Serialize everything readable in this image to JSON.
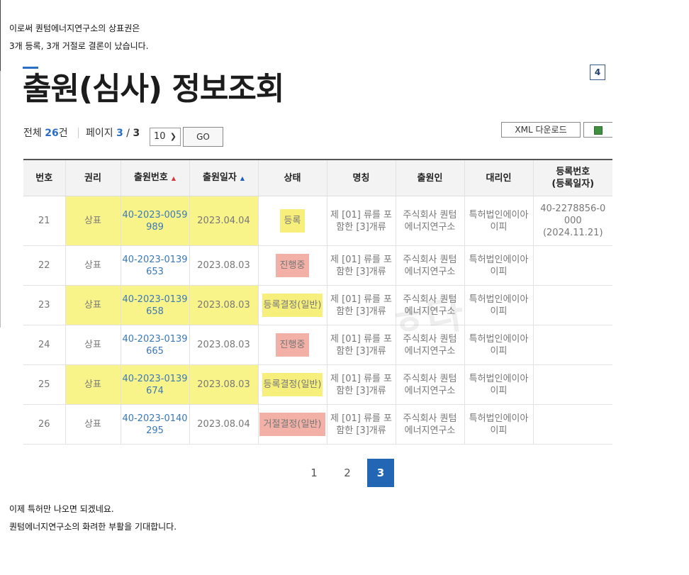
{
  "intro": {
    "line1": "이로써 퀀텀에너지연구소의 상표권은",
    "line2": "3개 등록, 3개 거절로 결론이 났습니다."
  },
  "screenshot": {
    "title": "출원(심사) 정보조회",
    "page_badge": "4",
    "summary": {
      "total_label": "전체",
      "total_count": "26",
      "total_unit": "건",
      "page_label": "페이지",
      "page_current": "3",
      "page_sep": "/",
      "page_total": "3"
    },
    "per_page_value": "10",
    "go_label": "GO",
    "xml_download_label": "XML 다운로드",
    "watermark": "ㅎ다",
    "columns": [
      "번호",
      "권리",
      "출원번호",
      "출원일자",
      "상태",
      "명칭",
      "출원인",
      "대리인",
      "등록번호\n(등록일자)"
    ],
    "rows": [
      {
        "no": "21",
        "right": "상표",
        "app_no": "40-2023-0059\n989",
        "date": "2023.04.04",
        "status": "등록",
        "name": "제 [01] 류를 포\n함한 [3]개류",
        "applicant": "주식회사 퀀텀\n에너지연구소",
        "agent": "특허법인에이아\n이피",
        "reg": "40-2278856-0\n000\n(2024.11.21)"
      },
      {
        "no": "22",
        "right": "상표",
        "app_no": "40-2023-0139\n653",
        "date": "2023.08.03",
        "status": "진행중",
        "name": "제 [01] 류를 포\n함한 [3]개류",
        "applicant": "주식회사 퀀텀\n에너지연구소",
        "agent": "특허법인에이아\n이피",
        "reg": ""
      },
      {
        "no": "23",
        "right": "상표",
        "app_no": "40-2023-0139\n658",
        "date": "2023.08.03",
        "status": "등록결정(일반)",
        "name": "제 [01] 류를 포\n함한 [3]개류",
        "applicant": "주식회사 퀀텀\n에너지연구소",
        "agent": "특허법인에이아\n이피",
        "reg": ""
      },
      {
        "no": "24",
        "right": "상표",
        "app_no": "40-2023-0139\n665",
        "date": "2023.08.03",
        "status": "진행중",
        "name": "제 [01] 류를 포\n함한 [3]개류",
        "applicant": "주식회사 퀀텀\n에너지연구소",
        "agent": "특허법인에이아\n이피",
        "reg": ""
      },
      {
        "no": "25",
        "right": "상표",
        "app_no": "40-2023-0139\n674",
        "date": "2023.08.03",
        "status": "등록결정(일반)",
        "name": "제 [01] 류를 포\n함한 [3]개류",
        "applicant": "주식회사 퀀텀\n에너지연구소",
        "agent": "특허법인에이아\n이피",
        "reg": ""
      },
      {
        "no": "26",
        "right": "상표",
        "app_no": "40-2023-0140\n295",
        "date": "2023.08.04",
        "status": "거절결정(일반)",
        "name": "제 [01] 류를 포\n함한 [3]개류",
        "applicant": "주식회사 퀀텀\n에너지연구소",
        "agent": "특허법인에이아\n이피",
        "reg": ""
      }
    ],
    "pagination": [
      "1",
      "2",
      "3"
    ],
    "current_page": "3"
  },
  "outro": {
    "line1": "이제 특허만 나오면 되겠네요.",
    "line2": "퀀텀에너지연구소의 화려한 부활을 기대합니다."
  },
  "colors": {
    "highlight_yellow": "#f9f48a",
    "status_red": "#f2b0a6",
    "link_blue": "#3a78b8",
    "active_page": "#2367b4"
  }
}
